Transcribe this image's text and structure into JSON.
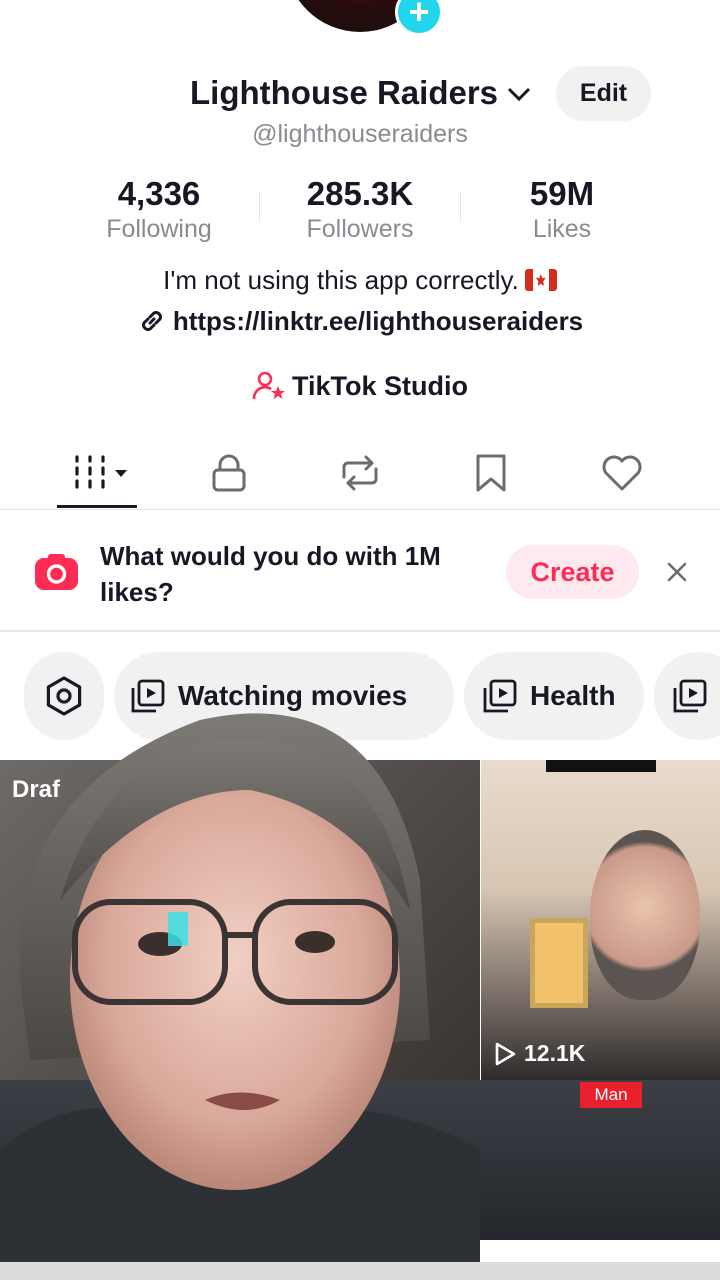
{
  "profile": {
    "display_name": "Lighthouse Raiders",
    "edit_label": "Edit",
    "handle": "@lighthouseraiders",
    "bio": "I'm not using this app correctly.",
    "link": "https://linktr.ee/lighthouseraiders",
    "studio_label": "TikTok Studio"
  },
  "stats": [
    {
      "value": "4,336",
      "label": "Following"
    },
    {
      "value": "285.3K",
      "label": "Followers"
    },
    {
      "value": "59M",
      "label": "Likes"
    }
  ],
  "tabs": [
    "videos-icon",
    "lock-icon",
    "repost-icon",
    "bookmark-icon",
    "heart-icon"
  ],
  "prompt": {
    "text": "What would you do with 1M likes?",
    "create_label": "Create"
  },
  "collections": [
    {
      "label": "Watching movies"
    },
    {
      "label": "Health"
    }
  ],
  "grid": {
    "draft_label": "Draf",
    "video_views": "12.1K",
    "badge_text": "Man"
  },
  "colors": {
    "accent": "#fe2c55",
    "plus_badge": "#20d5ec",
    "text": "#161823",
    "muted": "#8a8b91"
  }
}
